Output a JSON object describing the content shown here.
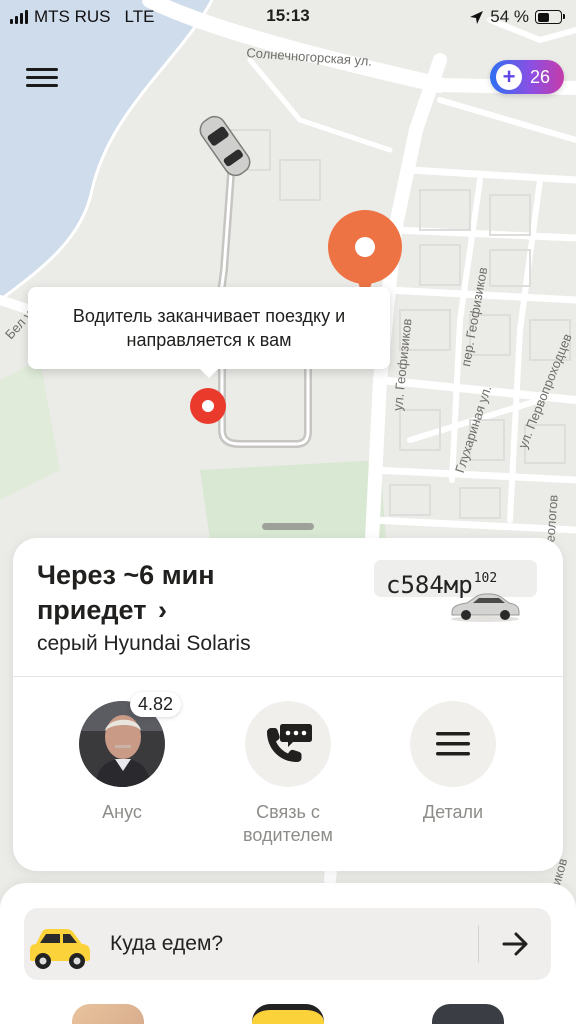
{
  "status_bar": {
    "carrier": "MTS RUS",
    "network": "LTE",
    "time": "15:13",
    "battery": "54 %",
    "battery_level": 0.54
  },
  "map": {
    "streets": [
      "Солнечногорская ул.",
      "ул. Геофизиков",
      "пер. Геофизиков",
      "Глухариная ул.",
      "ул. Первопроходцев",
      "Бел ул.",
      "Геологов",
      "Физиков"
    ],
    "colors": {
      "pickup_marker": "#ea3a2c",
      "destination_marker": "#ee7344",
      "water": "#cfdcec",
      "green": "#d9e8d3"
    }
  },
  "header": {
    "menu_icon": "hamburger-menu-icon",
    "plus_icon": "yandex-plus-icon",
    "plus_points": "26"
  },
  "tooltip": {
    "text": "Водитель заканчивает поездку и направляется к вам"
  },
  "ride": {
    "eta_line1": "Через ~6 мин",
    "eta_line2": "приедет",
    "chevron": "›",
    "car_description": "серый Hyundai Solaris",
    "plate_number": "с584мр",
    "plate_region": "102"
  },
  "actions": [
    {
      "label": "Анус",
      "icon": "driver-avatar",
      "rating": "4.82"
    },
    {
      "label": "Связь с водителем",
      "icon": "phone-chat-icon"
    },
    {
      "label": "Детали",
      "icon": "menu-lines-icon"
    }
  ],
  "destination": {
    "placeholder": "Куда едем?",
    "icon": "taxi-car-icon",
    "arrow_icon": "arrow-right-icon"
  }
}
